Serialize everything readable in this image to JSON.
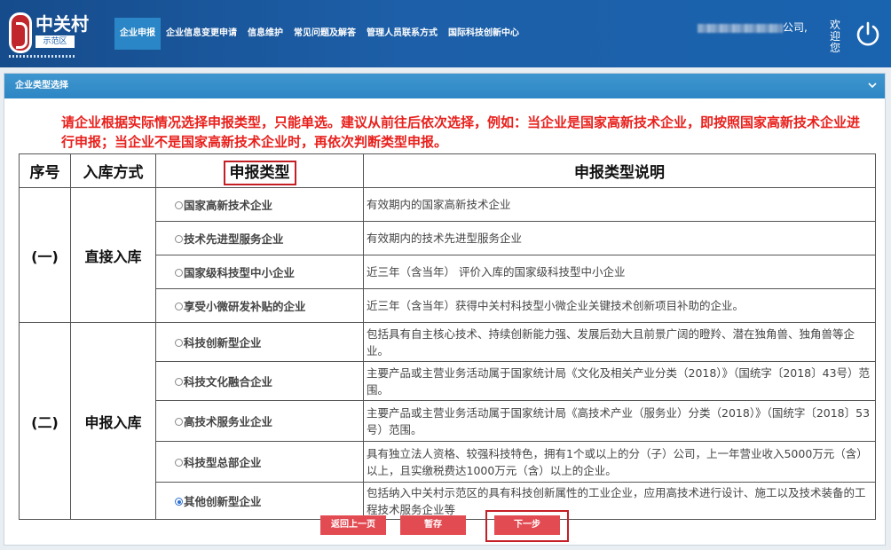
{
  "header": {
    "logo_text": "中关村",
    "logo_sub": "示范区",
    "nav": [
      {
        "label": "企业申报",
        "active": true
      },
      {
        "label": "企业信息变更申请",
        "active": false
      },
      {
        "label": "信息维护",
        "active": false
      },
      {
        "label": "常见问题及解答",
        "active": false
      },
      {
        "label": "管理人员联系方式",
        "active": false
      },
      {
        "label": "国际科技创新中心",
        "active": false
      }
    ],
    "user_suffix": "公司,",
    "welcome": "欢迎您"
  },
  "panel": {
    "title": "企业类型选择"
  },
  "notice": "请企业根据实际情况选择申报类型，只能单选。建议从前往后依次选择，例如：当企业是国家高新技术企业，即按照国家高新技术企业进行申报；当企业不是国家高新技术企业时，再依次判断类型申报。",
  "table": {
    "headers": [
      "序号",
      "入库方式",
      "申报类型",
      "申报类型说明"
    ],
    "groups": [
      {
        "no": "(一)",
        "method": "直接入库"
      },
      {
        "no": "(二)",
        "method": "申报入库"
      }
    ],
    "rows": [
      {
        "type": "国家高新技术企业",
        "desc": "有效期内的国家高新技术企业",
        "selected": false
      },
      {
        "type": "技术先进型服务企业",
        "desc": "有效期内的技术先进型服务企业",
        "selected": false
      },
      {
        "type": "国家级科技型中小企业",
        "desc": "近三年（含当年） 评价入库的国家级科技型中小企业",
        "selected": false
      },
      {
        "type": "享受小微研发补贴的企业",
        "desc": "近三年（含当年）获得中关村科技型小微企业关键技术创新项目补助的企业。",
        "selected": false
      },
      {
        "type": "科技创新型企业",
        "desc": "包括具有自主核心技术、持续创新能力强、发展后劲大且前景广阔的瞪羚、潜在独角兽、独角兽等企业。",
        "selected": false
      },
      {
        "type": "科技文化融合企业",
        "desc": "主要产品或主营业务活动属于国家统计局《文化及相关产业分类（2018）》（国统字〔2018〕43号）范围。",
        "selected": false
      },
      {
        "type": "高技术服务业企业",
        "desc": "主要产品或主营业务活动属于国家统计局《高技术产业（服务业）分类（2018）》（国统字〔2018〕53号）范围。",
        "selected": false
      },
      {
        "type": "科技型总部企业",
        "desc": "具有独立法人资格、较强科技特色，拥有1个或以上的分（子）公司，上一年营业收入5000万元（含）以上，且实缴税费达1000万元（含）以上的企业。",
        "selected": false
      },
      {
        "type": "其他创新型企业",
        "desc": "包括纳入中关村示范区的具有科技创新属性的工业企业，应用高技术进行设计、施工以及技术装备的工程技术服务企业等",
        "selected": true
      }
    ]
  },
  "buttons": {
    "back": "返回上一页",
    "save": "暂存",
    "next": "下一步"
  },
  "colors": {
    "header_blue": "#1d5fa8",
    "panel_head": "#2d86c4",
    "notice_red": "#e8201c",
    "button_red": "#e34b53",
    "highlight_red": "#c31f25"
  }
}
